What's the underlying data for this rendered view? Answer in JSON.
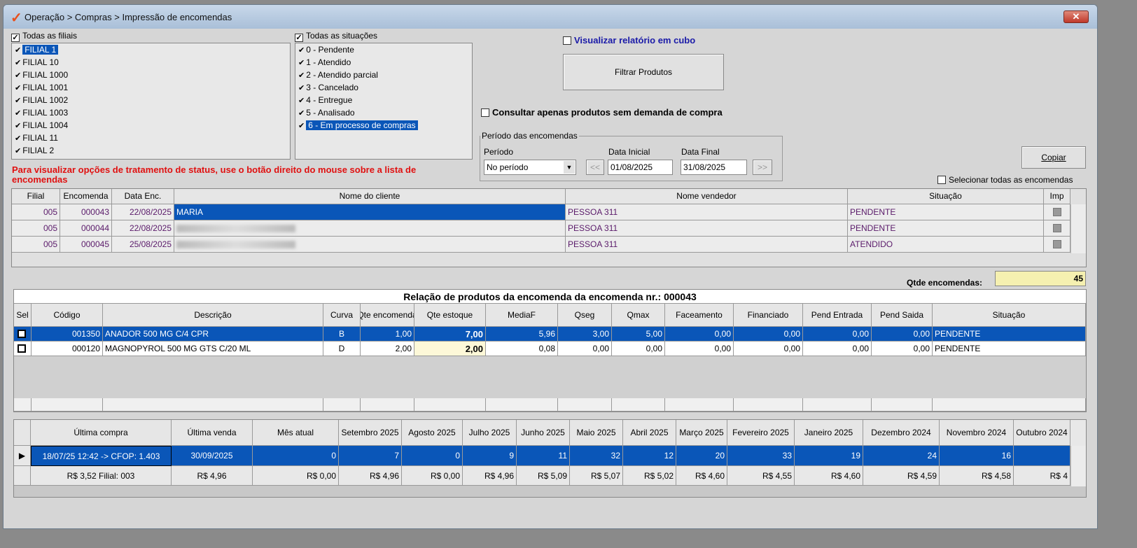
{
  "window": {
    "title": "Operação > Compras > Impressão de encomendas",
    "close": "✕"
  },
  "filiais": {
    "all_label": "Todas as filiais",
    "items": [
      "FILIAL 1",
      "FILIAL 10",
      "FILIAL 1000",
      "FILIAL 1001",
      "FILIAL 1002",
      "FILIAL 1003",
      "FILIAL 1004",
      "FILIAL 11",
      "FILIAL 2"
    ]
  },
  "situacoes": {
    "all_label": "Todas as situações",
    "items": [
      "0 - Pendente",
      "1 - Atendido",
      "2 - Atendido parcial",
      "3 - Cancelado",
      "4 - Entregue",
      "5 - Analisado",
      "6 - Em processo de compras"
    ]
  },
  "cubo_label": "Visualizar relatório em cubo",
  "filtrar_label": "Filtrar Produtos",
  "sem_demanda_label": "Consultar apenas produtos sem demanda de compra",
  "periodo": {
    "legend": "Período das encomendas",
    "periodo_label": "Período",
    "periodo_value": "No período",
    "data_inicial_label": "Data Inicial",
    "data_inicial": "01/08/2025",
    "data_final_label": "Data Final",
    "data_final": "31/08/2025",
    "prev": "<<",
    "next": ">>"
  },
  "copiar_label": "Copiar",
  "selecionar_todas_label": "Selecionar todas as encomendas",
  "hint": "Para visualizar opções de tratamento de status, use o botão direito do mouse sobre a lista de encomendas",
  "orders": {
    "headers": [
      "Filial",
      "Encomenda",
      "Data Enc.",
      "Nome do cliente",
      "Nome vendedor",
      "Situação",
      "Imp"
    ],
    "rows": [
      [
        "005",
        "000043",
        "22/08/2025",
        "MARIA",
        "PESSOA 311",
        "PENDENTE"
      ],
      [
        "005",
        "000044",
        "22/08/2025",
        "",
        "PESSOA 311",
        "PENDENTE"
      ],
      [
        "005",
        "000045",
        "25/08/2025",
        "",
        "PESSOA 311",
        "ATENDIDO"
      ]
    ]
  },
  "qtde": {
    "label": "Qtde encomendas:",
    "value": "45"
  },
  "products": {
    "title": "Relação de produtos da encomenda da encomenda nr.: 000043",
    "headers": [
      "Sel",
      "Código",
      "Descrição",
      "Curva",
      "Qte encomenda",
      "Qte estoque",
      "MediaF",
      "Qseg",
      "Qmax",
      "Faceamento",
      "Financiado",
      "Pend Entrada",
      "Pend Saida",
      "Situação"
    ],
    "rows": [
      [
        "",
        "001350",
        "ANADOR 500 MG C/4 CPR",
        "B",
        "1,00",
        "7,00",
        "5,96",
        "3,00",
        "5,00",
        "0,00",
        "0,00",
        "0,00",
        "0,00",
        "PENDENTE"
      ],
      [
        "",
        "000120",
        "MAGNOPYROL 500 MG GTS C/20 ML",
        "D",
        "2,00",
        "2,00",
        "0,08",
        "0,00",
        "0,00",
        "0,00",
        "0,00",
        "0,00",
        "0,00",
        "PENDENTE"
      ]
    ]
  },
  "history": {
    "headers": [
      "Última compra",
      "Última venda",
      "Mês atual",
      "Setembro 2025",
      "Agosto 2025",
      "Julho 2025",
      "Junho 2025",
      "Maio 2025",
      "Abril 2025",
      "Março 2025",
      "Fevereiro 2025",
      "Janeiro 2025",
      "Dezembro 2024",
      "Novembro 2024",
      "Outubro 2024"
    ],
    "rows": [
      [
        "18/07/25 12:42 -> CFOP: 1.403",
        "30/09/2025",
        "0",
        "7",
        "0",
        "9",
        "11",
        "32",
        "12",
        "20",
        "33",
        "19",
        "24",
        "16",
        ""
      ],
      [
        "R$ 3,52 Filial: 003",
        "R$ 4,96",
        "R$ 0,00",
        "R$ 4,96",
        "R$ 0,00",
        "R$ 4,96",
        "R$ 5,09",
        "R$ 5,07",
        "R$ 5,02",
        "R$ 4,60",
        "R$ 4,55",
        "R$ 4,60",
        "R$ 4,59",
        "R$ 4,58",
        "R$ 4"
      ]
    ]
  }
}
